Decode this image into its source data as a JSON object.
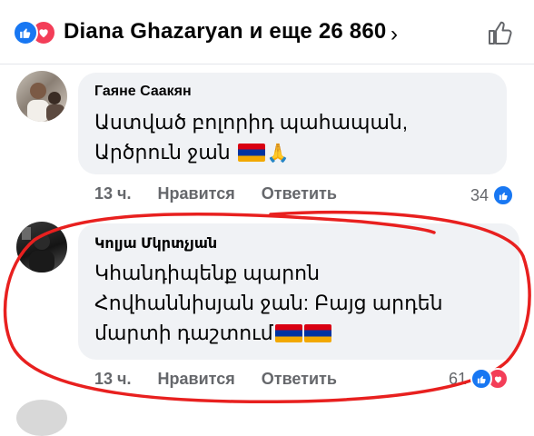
{
  "header": {
    "reactions_text": "Diana Ghazaryan и еще 26 860",
    "chevron": "›",
    "reaction_icons": [
      "like-icon",
      "love-icon"
    ]
  },
  "comments": [
    {
      "author": "Гаяне Саакян",
      "text_line1": "Աստված բոլորիդ պահապան,",
      "text_line2": "Արծրուն ջան",
      "time": "13 ч.",
      "like_label": "Нравится",
      "reply_label": "Ответить",
      "reaction_count": "34",
      "reaction_icons": [
        "like-icon"
      ]
    },
    {
      "author": "Կոլյա Մկրտչյան",
      "text_line1": "Կհանդիպենք պարոն",
      "text_line2": "Հովհաննիսյան ջան: Բայց արդեն",
      "text_line3": "մարտի դաշտում",
      "time": "13 ч.",
      "like_label": "Нравится",
      "reply_label": "Ответить",
      "reaction_count": "61",
      "reaction_icons": [
        "like-icon",
        "love-icon"
      ]
    }
  ],
  "colors": {
    "facebook_blue": "#1877f2",
    "love_red": "#f33e58",
    "bubble_bg": "#f0f2f5",
    "meta_gray": "#65676b",
    "annotation_red": "#e8201f"
  }
}
